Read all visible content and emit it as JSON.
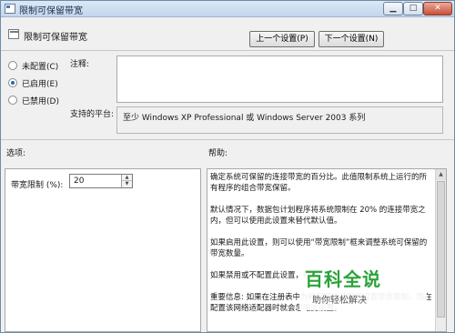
{
  "window": {
    "title": "限制可保留带宽",
    "icons": {
      "window": "policy-document-icon",
      "minimize": "minimize-icon",
      "maximize": "maximize-icon",
      "close": "close-icon"
    }
  },
  "header": {
    "title": "限制可保留带宽",
    "icon": "policy-setting-icon",
    "prev_button": "上一个设置(P)",
    "next_button": "下一个设置(N)"
  },
  "state": {
    "options": [
      {
        "label": "未配置(C)",
        "selected": false
      },
      {
        "label": "已启用(E)",
        "selected": true
      },
      {
        "label": "已禁用(D)",
        "selected": false
      }
    ]
  },
  "comment": {
    "label": "注释:",
    "value": ""
  },
  "platform": {
    "label": "支持的平台:",
    "value": "至少 Windows XP Professional 或 Windows Server 2003 系列"
  },
  "options_section": {
    "title": "选项:",
    "bandwidth_label": "带宽限制 (%):",
    "bandwidth_value": "20"
  },
  "help_section": {
    "title": "帮助:",
    "paragraphs": [
      "确定系统可保留的连接带宽的百分比。此值限制系统上运行的所有程序的组合带宽保留。",
      "默认情况下，数据包计划程序将系统限制在 20% 的连接带宽之内，但可以使用此设置来替代默认值。",
      "如果启用此设置，则可以使用“带宽限制”框来调整系统可保留的带宽数量。",
      "如果禁用或不配置此设置，则系",
      "重要信息: 如果在注册表中为特定网络适配器设置带宽限制，则在配置该网络适配器时就会忽略此设置。"
    ]
  },
  "watermark": {
    "main": "百科全说",
    "sub": "助你轻松解决"
  },
  "colors": {
    "watermark_green": "#29a33a",
    "titlebar": "#c3d6ec"
  }
}
